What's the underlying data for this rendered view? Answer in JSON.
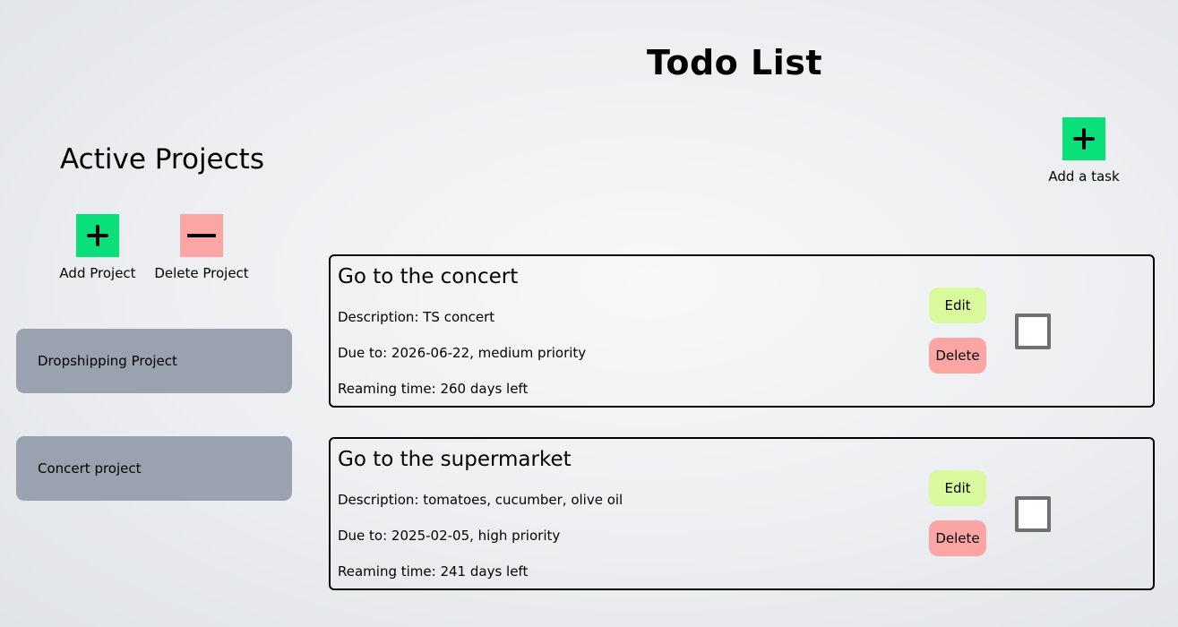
{
  "header": {
    "title": "Todo List"
  },
  "toolbar": {
    "add_task_label": "Add a task",
    "add_task_icon": "plus-icon",
    "accent_green": "#0ae07a"
  },
  "sidebar": {
    "title": "Active Projects",
    "add_project_label": "Add Project",
    "delete_project_label": "Delete Project",
    "add_icon": "plus-icon",
    "delete_icon": "minus-icon",
    "delete_color": "#fca5a5",
    "projects": [
      {
        "label": "Dropshipping Project"
      },
      {
        "label": "Concert project"
      }
    ]
  },
  "tasks": [
    {
      "title": "Go to the concert",
      "description": "Description: TS concert",
      "due": "Due to: 2026-06-22, medium priority",
      "remaining": "Reaming time: 260 days left",
      "edit_label": "Edit",
      "delete_label": "Delete",
      "done": false
    },
    {
      "title": "Go to the supermarket",
      "description": "Description: tomatoes, cucumber, olive oil",
      "due": "Due to: 2025-02-05, high priority",
      "remaining": "Reaming time: 241 days left",
      "edit_label": "Edit",
      "delete_label": "Delete",
      "done": false
    }
  ]
}
